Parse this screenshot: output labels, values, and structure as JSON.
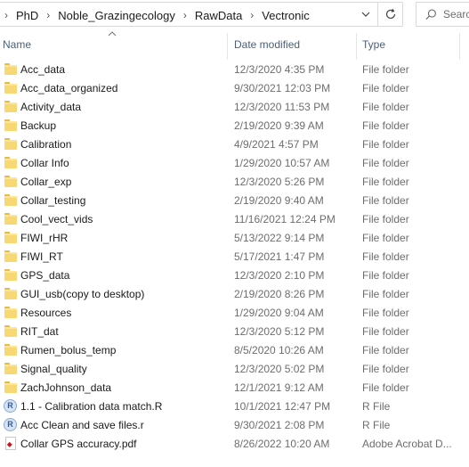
{
  "address": {
    "crumbs": [
      "PhD",
      "Noble_Grazingecology",
      "RawData",
      "Vectronic"
    ],
    "search_placeholder": "Search"
  },
  "columns": {
    "name": "Name",
    "date": "Date modified",
    "type": "Type"
  },
  "rows": [
    {
      "name": "Acc_data",
      "date": "12/3/2020 4:35 PM",
      "type": "File folder",
      "icon": "folder-icon"
    },
    {
      "name": "Acc_data_organized",
      "date": "9/30/2021 12:03 PM",
      "type": "File folder",
      "icon": "folder-icon"
    },
    {
      "name": "Activity_data",
      "date": "12/3/2020 11:53 PM",
      "type": "File folder",
      "icon": "folder-icon"
    },
    {
      "name": "Backup",
      "date": "2/19/2020 9:39 AM",
      "type": "File folder",
      "icon": "folder-icon"
    },
    {
      "name": "Calibration",
      "date": "4/9/2021 4:57 PM",
      "type": "File folder",
      "icon": "folder-icon"
    },
    {
      "name": "Collar Info",
      "date": "1/29/2020 10:57 AM",
      "type": "File folder",
      "icon": "folder-icon"
    },
    {
      "name": "Collar_exp",
      "date": "12/3/2020 5:26 PM",
      "type": "File folder",
      "icon": "folder-icon"
    },
    {
      "name": "Collar_testing",
      "date": "2/19/2020 9:40 AM",
      "type": "File folder",
      "icon": "folder-icon"
    },
    {
      "name": "Cool_vect_vids",
      "date": "11/16/2021 12:24 PM",
      "type": "File folder",
      "icon": "folder-icon"
    },
    {
      "name": "FIWI_rHR",
      "date": "5/13/2022 9:14 PM",
      "type": "File folder",
      "icon": "folder-icon"
    },
    {
      "name": "FIWI_RT",
      "date": "5/17/2021 1:47 PM",
      "type": "File folder",
      "icon": "folder-icon"
    },
    {
      "name": "GPS_data",
      "date": "12/3/2020 2:10 PM",
      "type": "File folder",
      "icon": "folder-icon"
    },
    {
      "name": "GUI_usb(copy to desktop)",
      "date": "2/19/2020 8:26 PM",
      "type": "File folder",
      "icon": "folder-icon"
    },
    {
      "name": "Resources",
      "date": "1/29/2020 9:04 AM",
      "type": "File folder",
      "icon": "folder-icon"
    },
    {
      "name": "RIT_dat",
      "date": "12/3/2020 5:12 PM",
      "type": "File folder",
      "icon": "folder-icon"
    },
    {
      "name": "Rumen_bolus_temp",
      "date": "8/5/2020 10:26 AM",
      "type": "File folder",
      "icon": "folder-icon"
    },
    {
      "name": "Signal_quality",
      "date": "12/3/2020 5:02 PM",
      "type": "File folder",
      "icon": "folder-icon"
    },
    {
      "name": "ZachJohnson_data",
      "date": "12/1/2021 9:12 AM",
      "type": "File folder",
      "icon": "folder-icon"
    },
    {
      "name": "1.1 - Calibration data match.R",
      "date": "10/1/2021 12:47 PM",
      "type": "R File",
      "icon": "r-file-icon"
    },
    {
      "name": "Acc Clean and save files.r",
      "date": "9/30/2021 2:08 PM",
      "type": "R File",
      "icon": "r-file-icon"
    },
    {
      "name": "Collar GPS accuracy.pdf",
      "date": "8/26/2022 10:20 AM",
      "type": "Adobe Acrobat D...",
      "icon": "pdf-file-icon"
    }
  ]
}
